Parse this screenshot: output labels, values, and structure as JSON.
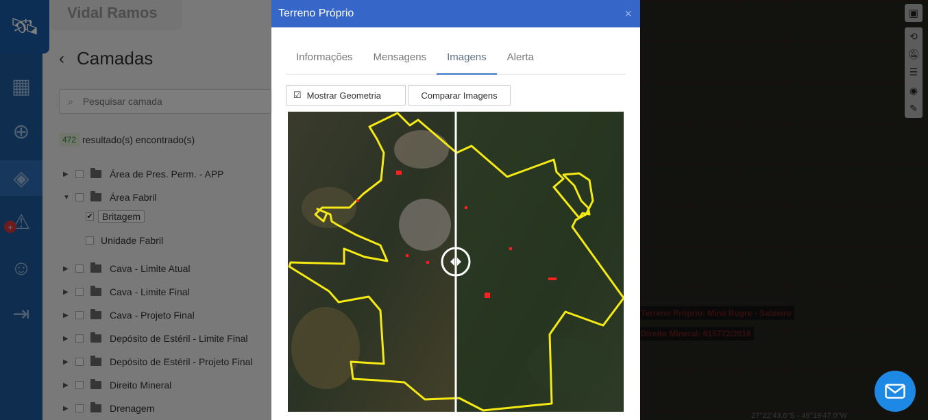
{
  "rail": {
    "items": [
      "satellite-icon",
      "apps-grid-icon",
      "crosshair-icon",
      "layers-icon",
      "alert-icon",
      "user-icon",
      "logout-icon"
    ],
    "badge": "+"
  },
  "panel": {
    "top_label": "Vidal Ramos",
    "title": "Camadas",
    "search_placeholder": "Pesquisar camada",
    "result_count": "472",
    "result_text": "resultado(s) encontrado(s)",
    "layers": [
      {
        "label": "Área de Pres. Perm. - APP"
      },
      {
        "label": "Área Fabril"
      },
      {
        "label": "Britagem"
      },
      {
        "label": "Unidade Fabril"
      },
      {
        "label": "Cava - Limite Atual"
      },
      {
        "label": "Cava - Limite Final"
      },
      {
        "label": "Cava - Projeto Final"
      },
      {
        "label": "Depósito de Estéril - Limite Final"
      },
      {
        "label": "Depósito de Estéril - Projeto Final"
      },
      {
        "label": "Direito Mineral"
      },
      {
        "label": "Drenagem"
      }
    ]
  },
  "map": {
    "label_terreno": "Terreno Próprio: Mina Bugre - Salseiro",
    "label_direito": "Direito Mineral: 815772/2016",
    "coords": "27°22'43.6\"S - 49°19'47.0\"W",
    "overlay_color": "#6b1e1e"
  },
  "modal": {
    "title": "Terreno Próprio",
    "close": "×",
    "tabs": [
      {
        "label": "Informações"
      },
      {
        "label": "Mensagens"
      },
      {
        "label": "Imagens"
      },
      {
        "label": "Alerta"
      }
    ],
    "active_tab": "Imagens",
    "show_geometry_label": "Mostrar Geometria",
    "compare_label": "Comparar Imagens",
    "slider_position": 0.5,
    "accent_color": "#3666c8",
    "geometry_color": "#f5ea14"
  },
  "fab": {
    "icon": "mail-icon",
    "color": "#1e88e5"
  }
}
